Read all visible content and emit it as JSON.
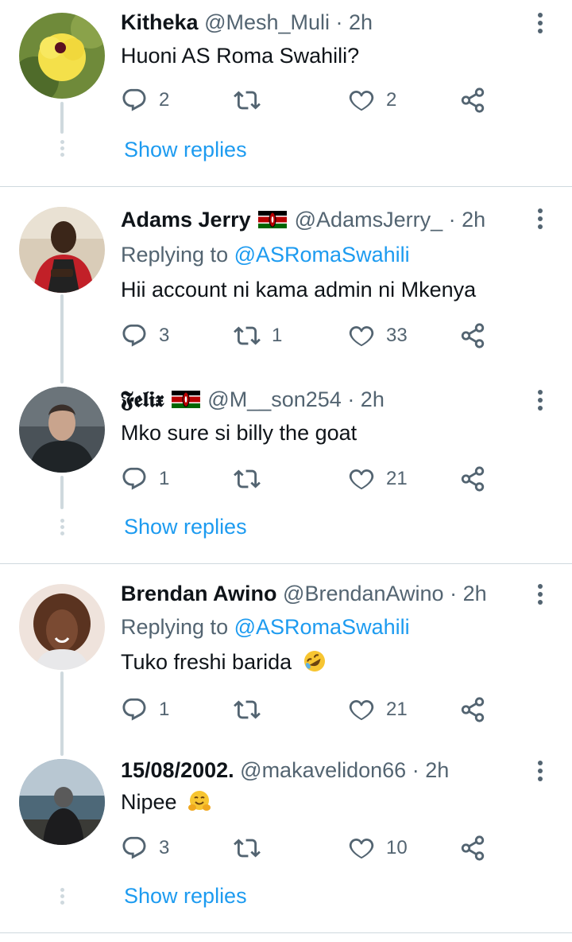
{
  "tweets": [
    {
      "name": "Kitheka",
      "handle": "@Mesh_Muli",
      "time": "· 2h",
      "text": "Huoni AS Roma Swahili?",
      "replies": "2",
      "retweets": "",
      "likes": "2",
      "show_replies": "Show replies"
    },
    {
      "name": "Adams Jerry",
      "handle": "@AdamsJerry_",
      "time": "· 2h",
      "replying_prefix": "Replying to",
      "replying_to": "@ASRomaSwahili",
      "text": "Hii account ni kama admin ni Mkenya",
      "replies": "3",
      "retweets": "1",
      "likes": "33"
    },
    {
      "name": "𝕱𝖊𝖑𝖎𝖝",
      "handle": "@M__son254",
      "time": "· 2h",
      "text": "Mko sure si billy the goat",
      "replies": "1",
      "retweets": "",
      "likes": "21",
      "show_replies": "Show replies"
    },
    {
      "name": "Brendan Awino",
      "handle": "@BrendanAwino",
      "time": "· 2h",
      "replying_prefix": "Replying to",
      "replying_to": "@ASRomaSwahili",
      "text": "Tuko freshi barida",
      "emoji": "rolling-on-floor-laughing-emoji",
      "replies": "1",
      "retweets": "",
      "likes": "21"
    },
    {
      "name": "15/08/2002.",
      "handle": "@makavelidon66",
      "time": "· 2h",
      "text": "Nipee",
      "emoji": "hugging-face-emoji",
      "replies": "3",
      "retweets": "",
      "likes": "10",
      "show_replies": "Show replies"
    }
  ],
  "colors": {
    "link": "#1d9bf0",
    "muted": "#536471",
    "line": "#cfd9de"
  }
}
